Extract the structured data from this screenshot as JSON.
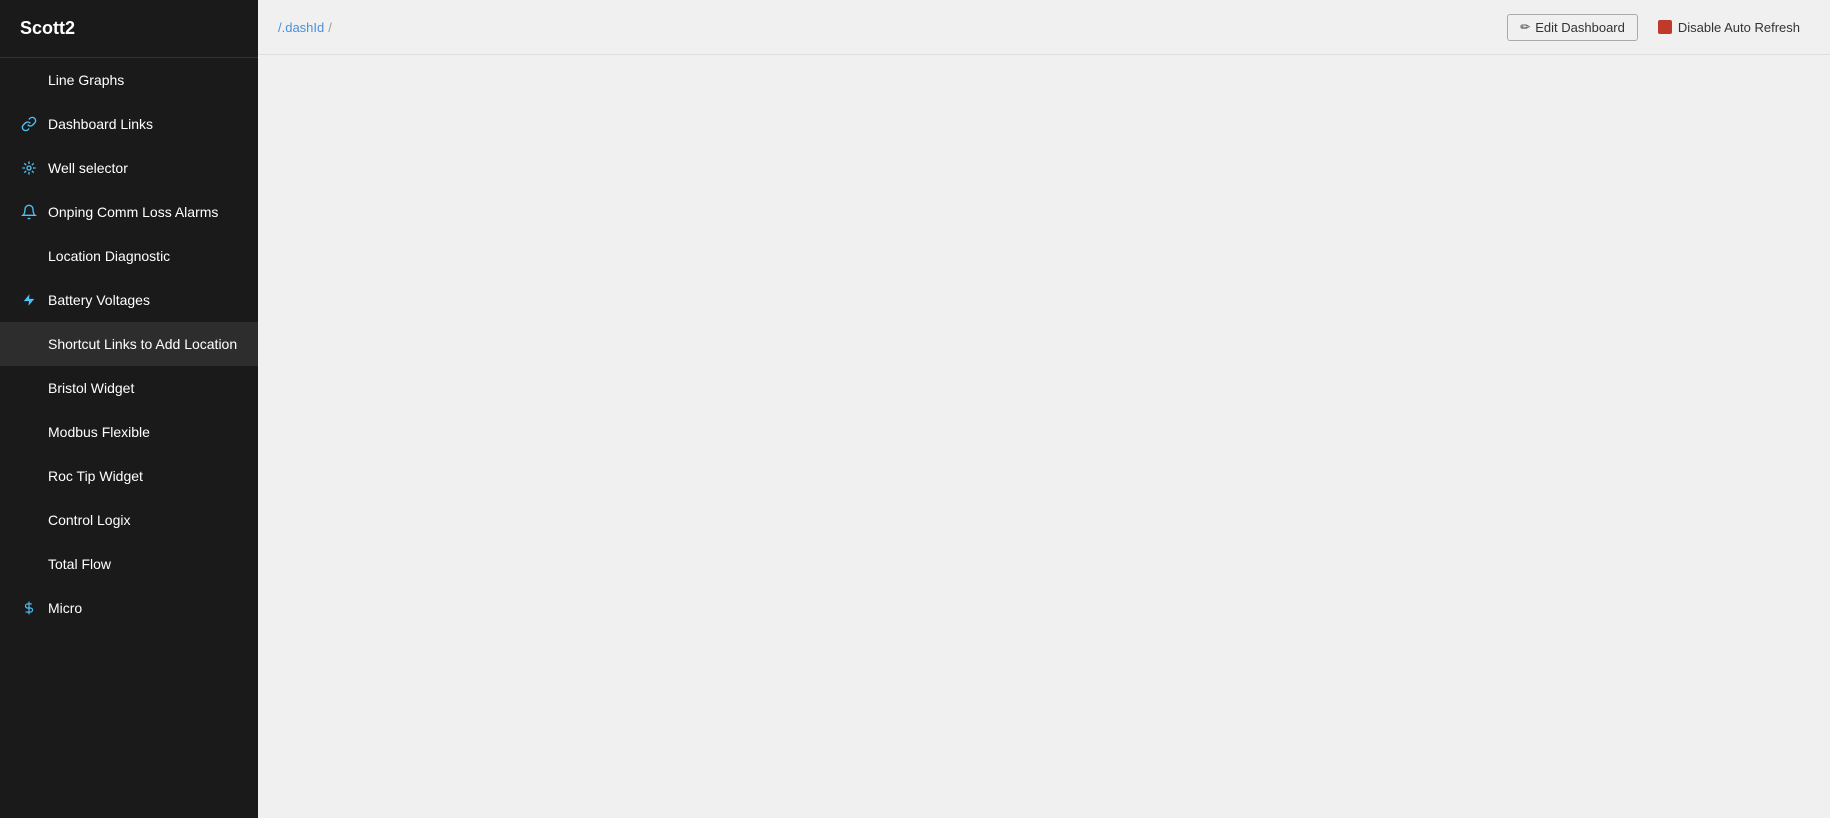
{
  "app": {
    "title": "Scott2"
  },
  "breadcrumb": {
    "path": "/.dashId",
    "separator": "/",
    "segments": [
      {
        "text": "/.dashId",
        "link": true
      },
      {
        "text": "/",
        "link": false
      }
    ]
  },
  "topbar": {
    "edit_dashboard_label": "Edit Dashboard",
    "disable_refresh_label": "Disable Auto Refresh"
  },
  "sidebar": {
    "items": [
      {
        "id": "line-graphs",
        "label": "Line Graphs",
        "icon": "chart",
        "has_icon": false,
        "active": false
      },
      {
        "id": "dashboard-links",
        "label": "Dashboard Links",
        "icon": "link",
        "has_icon": true,
        "active": false
      },
      {
        "id": "well-selector",
        "label": "Well selector",
        "icon": "well",
        "has_icon": true,
        "active": false
      },
      {
        "id": "onping-comm-loss",
        "label": "Onping Comm Loss Alarms",
        "icon": "bell",
        "has_icon": true,
        "active": false
      },
      {
        "id": "location-diagnostic",
        "label": "Location Diagnostic",
        "icon": "diag",
        "has_icon": false,
        "active": false
      },
      {
        "id": "battery-voltages",
        "label": "Battery Voltages",
        "icon": "bolt",
        "has_icon": true,
        "active": false
      },
      {
        "id": "shortcut-links",
        "label": "Shortcut Links to Add Location",
        "icon": "shortcut",
        "has_icon": false,
        "active": true
      },
      {
        "id": "bristol-widget",
        "label": "Bristol Widget",
        "icon": "bristol",
        "has_icon": false,
        "active": false
      },
      {
        "id": "modbus-flexible",
        "label": "Modbus Flexible",
        "icon": "modbus",
        "has_icon": false,
        "active": false
      },
      {
        "id": "roc-tip-widget",
        "label": "Roc Tip Widget",
        "icon": "roc",
        "has_icon": false,
        "active": false
      },
      {
        "id": "control-logix",
        "label": "Control Logix",
        "icon": "control",
        "has_icon": false,
        "active": false
      },
      {
        "id": "total-flow",
        "label": "Total Flow",
        "icon": "flow",
        "has_icon": false,
        "active": false
      },
      {
        "id": "micro",
        "label": "Micro",
        "icon": "micro",
        "has_icon": true,
        "active": false
      }
    ]
  }
}
